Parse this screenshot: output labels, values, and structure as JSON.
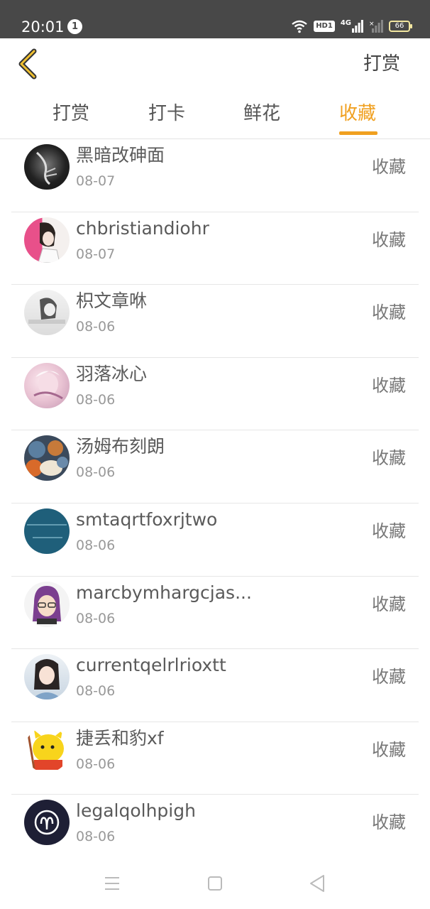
{
  "status_bar": {
    "time": "20:01",
    "notification_count": "1",
    "hd_label": "HD1",
    "network": "4G",
    "battery": "66"
  },
  "header": {
    "right_action": "打赏"
  },
  "tabs": [
    {
      "label": "打赏",
      "active": false
    },
    {
      "label": "打卡",
      "active": false
    },
    {
      "label": "鲜花",
      "active": false
    },
    {
      "label": "收藏",
      "active": true
    }
  ],
  "list": {
    "items": [
      {
        "name": "黑暗改砷面",
        "date": "08-07",
        "action": "收藏"
      },
      {
        "name": "chbristiandiohr",
        "date": "08-07",
        "action": "收藏"
      },
      {
        "name": "枳文章咻",
        "date": "08-06",
        "action": "收藏"
      },
      {
        "name": "羽落冰心",
        "date": "08-06",
        "action": "收藏"
      },
      {
        "name": "汤姆布刻朗",
        "date": "08-06",
        "action": "收藏"
      },
      {
        "name": "smtaqrtfoxrjtwo",
        "date": "08-06",
        "action": "收藏"
      },
      {
        "name": "marcbymhargcjas...",
        "date": "08-06",
        "action": "收藏"
      },
      {
        "name": "currentqelrlrioxtt",
        "date": "08-06",
        "action": "收藏"
      },
      {
        "name": "捷丢和豹xf",
        "date": "08-06",
        "action": "收藏"
      },
      {
        "name": "legalqolhpigh",
        "date": "08-06",
        "action": "收藏"
      }
    ]
  },
  "colors": {
    "accent": "#f0a020",
    "status_bar": "#484848"
  },
  "icons": {
    "back": "chevron-left-icon",
    "nav_menu": "menu-icon",
    "nav_home": "home-square-icon",
    "nav_back": "back-triangle-icon"
  }
}
